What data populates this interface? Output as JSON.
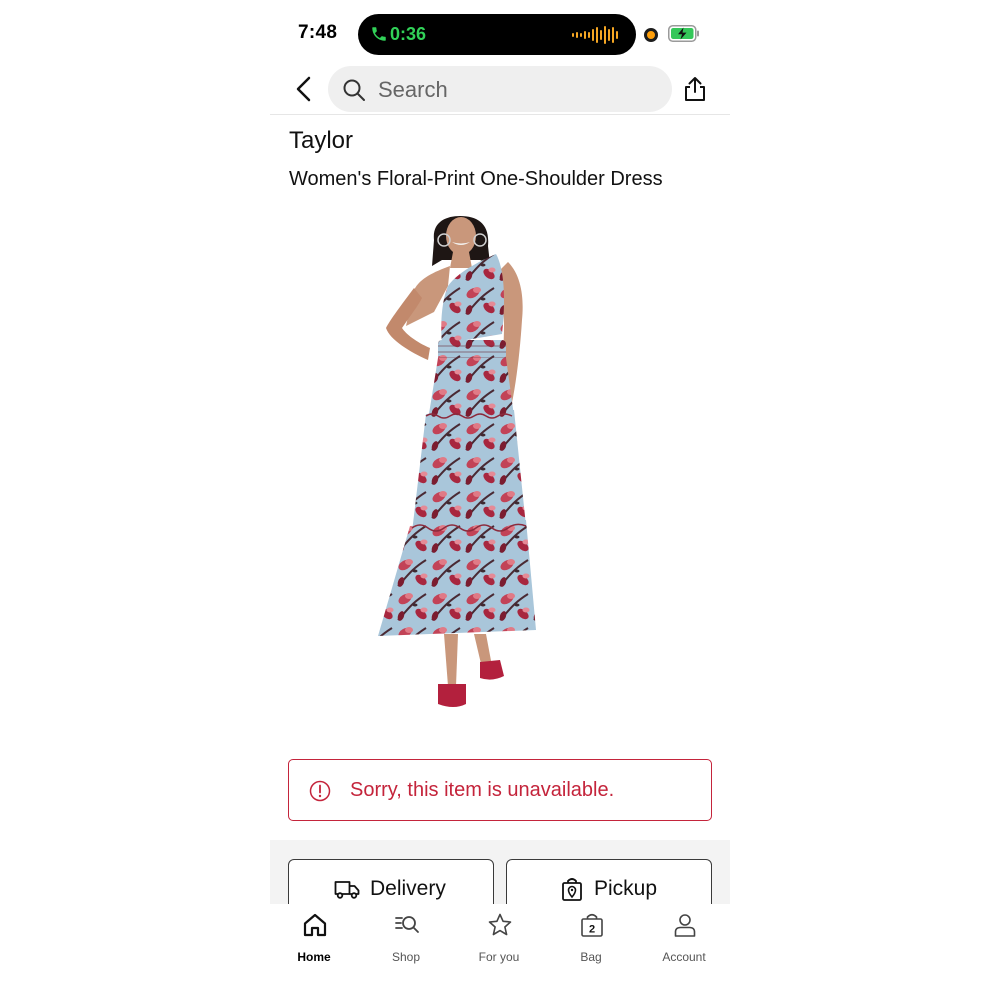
{
  "status_bar": {
    "time": "7:48",
    "call_timer": "0:36",
    "call_color": "#31d158",
    "camera_indicator_color": "#ff9f0a",
    "battery_icon": "battery-charging-icon"
  },
  "header": {
    "back_icon": "chevron-left-icon",
    "search": {
      "placeholder": "Search",
      "value": ""
    },
    "share_icon": "share-icon"
  },
  "product": {
    "brand": "Taylor",
    "name": "Women's Floral-Print One-Shoulder Dress",
    "image_icon": "product-photo"
  },
  "alert": {
    "icon": "exclamation-circle-icon",
    "message": "Sorry, this item is unavailable.",
    "color": "#c4243b"
  },
  "fulfillment": {
    "delivery_label": "Delivery",
    "delivery_icon": "truck-icon",
    "pickup_label": "Pickup",
    "pickup_icon": "shopping-bag-pin-icon"
  },
  "tabbar": {
    "tabs": [
      {
        "label": "Home",
        "icon": "home-icon",
        "active": true
      },
      {
        "label": "Shop",
        "icon": "list-search-icon",
        "active": false
      },
      {
        "label": "For you",
        "icon": "star-icon",
        "active": false
      },
      {
        "label": "Bag",
        "icon": "bag-icon",
        "badge": "2",
        "active": false
      },
      {
        "label": "Account",
        "icon": "person-icon",
        "active": false
      }
    ]
  }
}
